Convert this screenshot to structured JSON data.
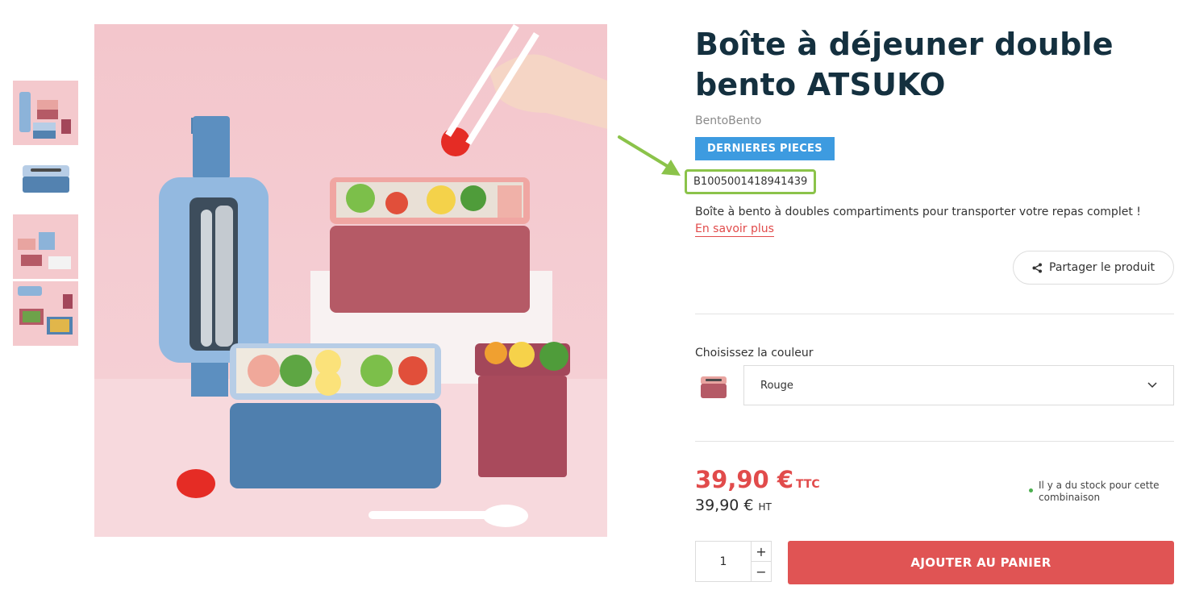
{
  "product": {
    "title": "Boîte à déjeuner double bento ATSUKO",
    "brand": "BentoBento",
    "badge": "DERNIERES PIECES",
    "reference": "B1005001418941439",
    "description": "Boîte à bento à doubles compartiments pour transporter votre repas complet !",
    "more_link": "En savoir plus"
  },
  "share": {
    "label": "Partager le produit",
    "icon": "share-icon"
  },
  "color": {
    "label": "Choisissez la couleur",
    "selected": "Rouge",
    "icon": "chevron-down-icon"
  },
  "price": {
    "ttc": "39,90 €",
    "ttc_suffix": "TTC",
    "ht": "39,90 €",
    "ht_suffix": "HT"
  },
  "stock": {
    "text": "Il y a du stock pour cette combinaison",
    "color": "#4caf50"
  },
  "cart": {
    "quantity": "1",
    "plus": "+",
    "minus": "−",
    "button": "AJOUTER AU PANIER"
  },
  "colors": {
    "title": "#14303f",
    "accent": "#e14b4b",
    "badge": "#3d9be0",
    "highlight": "#8bc34a"
  }
}
